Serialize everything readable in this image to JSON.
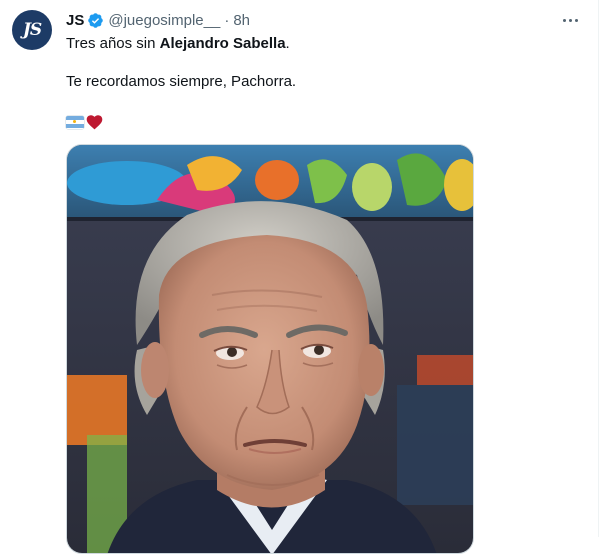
{
  "tweet": {
    "avatar_initials": "JS",
    "display_name": "JS",
    "handle": "@juegosimple__",
    "separator": "·",
    "time": "8h",
    "line1_prefix": "Tres años sin ",
    "line1_bold": "Alejandro Sabella",
    "line1_suffix": ".",
    "line2": "Te recordamos siempre, Pachorra.",
    "emojis": [
      "flag-argentina-icon",
      "red-heart-icon"
    ]
  },
  "colors": {
    "verified": "#1d9bf0",
    "handle_gray": "#536471",
    "heart": "#be1931",
    "avatar_bg": "#1d3b66"
  }
}
